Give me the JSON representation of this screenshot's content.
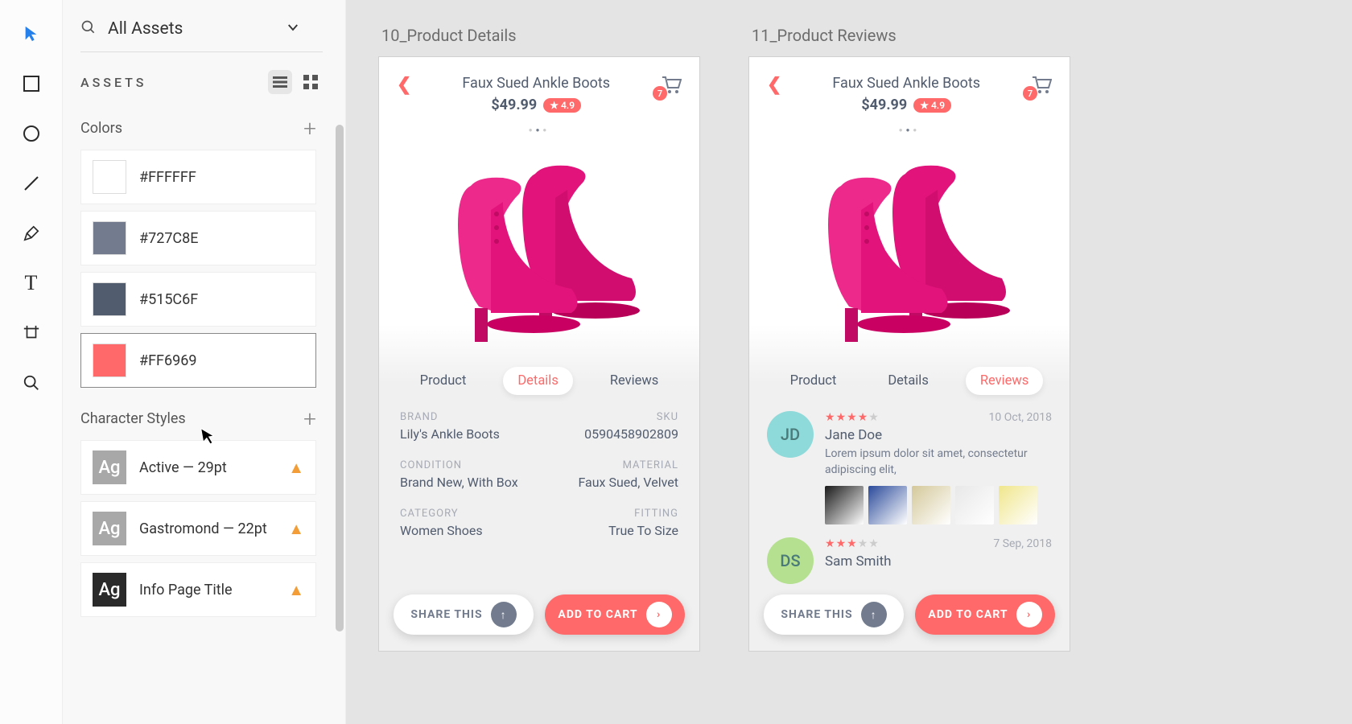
{
  "toolbar": {
    "tools": [
      "select",
      "rectangle",
      "ellipse",
      "line",
      "pen",
      "text",
      "artboard",
      "zoom"
    ]
  },
  "panel": {
    "search_label": "All Assets",
    "header": "ASSETS",
    "sections": {
      "colors": {
        "title": "Colors",
        "items": [
          {
            "hex": "#FFFFFF",
            "label": "#FFFFFF"
          },
          {
            "hex": "#727C8E",
            "label": "#727C8E"
          },
          {
            "hex": "#515C6F",
            "label": "#515C6F"
          },
          {
            "hex": "#FF6969",
            "label": "#FF6969",
            "selected": true
          }
        ]
      },
      "styles": {
        "title": "Character Styles",
        "items": [
          {
            "label": "Active — 29pt",
            "warn": true
          },
          {
            "label": "Gastromond — 22pt",
            "warn": true
          },
          {
            "label": "Info Page Title",
            "warn": true,
            "dark": true
          }
        ]
      }
    }
  },
  "canvas": {
    "artboards": [
      {
        "name": "10_Product Details",
        "product_title": "Faux Sued Ankle Boots",
        "price": "$49.99",
        "rating": "4.9",
        "cart_count": "7",
        "tabs": [
          "Product",
          "Details",
          "Reviews"
        ],
        "active_tab": 1,
        "details": [
          {
            "label": "BRAND",
            "value": "Lily's Ankle Boots"
          },
          {
            "label": "SKU",
            "value": "0590458902809",
            "right": true
          },
          {
            "label": "CONDITION",
            "value": "Brand New, With Box"
          },
          {
            "label": "MATERIAL",
            "value": "Faux Sued, Velvet",
            "right": true
          },
          {
            "label": "CATEGORY",
            "value": "Women Shoes"
          },
          {
            "label": "FITTING",
            "value": "True To Size",
            "right": true
          }
        ]
      },
      {
        "name": "11_Product Reviews",
        "product_title": "Faux Sued Ankle Boots",
        "price": "$49.99",
        "rating": "4.9",
        "cart_count": "7",
        "tabs": [
          "Product",
          "Details",
          "Reviews"
        ],
        "active_tab": 2,
        "reviews": [
          {
            "initials": "JD",
            "avatar_color": "#8ed9d9",
            "stars": 4,
            "name": "Jane Doe",
            "date": "10 Oct, 2018",
            "text": "Lorem ipsum dolor sit amet, consectetur adipiscing elit,",
            "thumbs": 5
          },
          {
            "initials": "DS",
            "avatar_color": "#b4e08f",
            "stars": 3,
            "name": "Sam Smith",
            "date": "7 Sep, 2018",
            "text": ""
          }
        ]
      }
    ],
    "buttons": {
      "share": "SHARE THIS",
      "cart": "ADD TO CART"
    }
  }
}
